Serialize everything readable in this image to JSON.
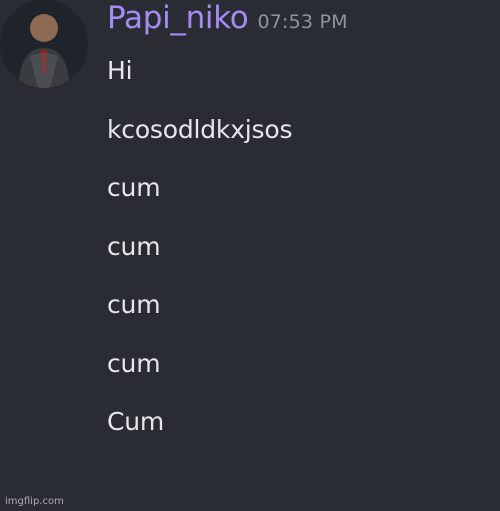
{
  "chat": {
    "username": "Papi_niko",
    "timestamp": "07:53 PM",
    "messages": [
      "Hi",
      "kcosodldkxjsos",
      "cum",
      "cum",
      "cum",
      "cum",
      "Cum"
    ]
  },
  "watermark": "imgflip.com",
  "colors": {
    "background": "#2a2c33",
    "username": "#a68cf2",
    "timestamp": "#8f939b",
    "message_text": "#e6e7ea"
  },
  "icons": {
    "avatar": "user-avatar-image"
  }
}
